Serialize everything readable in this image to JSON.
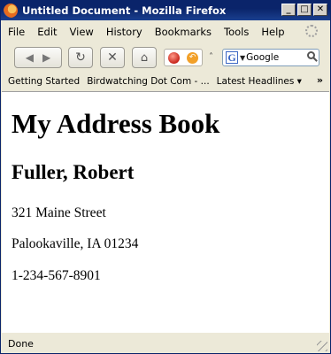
{
  "window": {
    "title": "Untitled Document - Mozilla Firefox"
  },
  "menubar": {
    "items": [
      "File",
      "Edit",
      "View",
      "History",
      "Bookmarks",
      "Tools",
      "Help"
    ]
  },
  "search": {
    "engine": "Google",
    "value": "Google"
  },
  "bookmarks": {
    "items": [
      "Getting Started",
      "Birdwatching Dot Com - ...",
      "Latest Headlines ▾"
    ]
  },
  "page": {
    "heading": "My Address Book",
    "name": "Fuller, Robert",
    "street": "321 Maine Street",
    "city": "Palookaville, IA 01234",
    "phone": "1-234-567-8901"
  },
  "status": {
    "text": "Done"
  }
}
